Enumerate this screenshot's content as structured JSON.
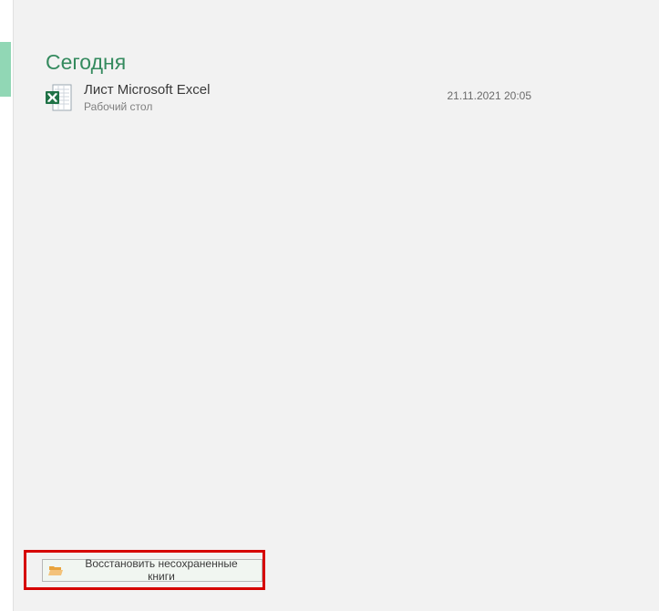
{
  "section_heading": "Сегодня",
  "recent_files": [
    {
      "title": "Лист Microsoft Excel",
      "location": "Рабочий стол",
      "modified": "21.11.2021 20:05"
    }
  ],
  "recover_button_label": "Восстановить несохраненные книги"
}
